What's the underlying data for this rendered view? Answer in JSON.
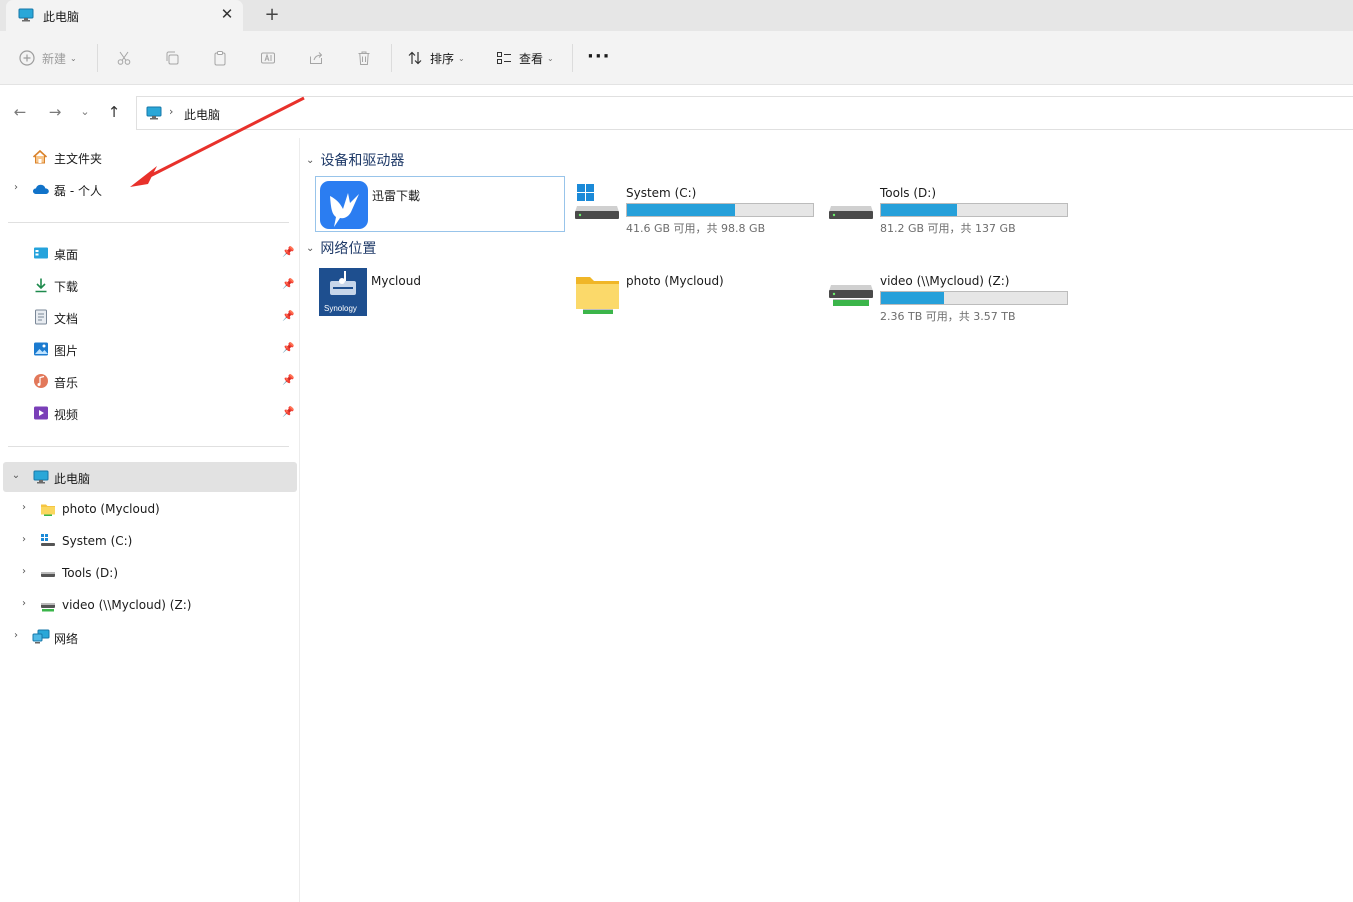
{
  "tab": {
    "title": "此电脑",
    "close": "✕",
    "new_tab": "+"
  },
  "toolbar": {
    "new_label": "新建",
    "sort_label": "排序",
    "view_label": "查看",
    "more": "···"
  },
  "address": {
    "crumb": "此电脑"
  },
  "sidebar": {
    "home": "主文件夹",
    "onedrive": "磊 - 个人",
    "quick": [
      {
        "label": "桌面"
      },
      {
        "label": "下载"
      },
      {
        "label": "文档"
      },
      {
        "label": "图片"
      },
      {
        "label": "音乐"
      },
      {
        "label": "视频"
      }
    ],
    "this_pc": "此电脑",
    "pc_children": [
      {
        "label": "photo (Mycloud)"
      },
      {
        "label": "System (C:)"
      },
      {
        "label": "Tools (D:)"
      },
      {
        "label": "video (\\\\Mycloud) (Z:)"
      }
    ],
    "network": "网络"
  },
  "main": {
    "devices_header": "设备和驱动器",
    "network_header": "网络位置",
    "devices": [
      {
        "name": "迅雷下載"
      },
      {
        "name": "System (C:)",
        "size_text": "41.6 GB 可用，共 98.8 GB",
        "used_fraction": 0.58
      },
      {
        "name": "Tools (D:)",
        "size_text": "81.2 GB 可用，共 137 GB",
        "used_fraction": 0.41
      }
    ],
    "network_items": [
      {
        "name": "Mycloud",
        "logo_text": "Synology"
      },
      {
        "name": "photo (Mycloud)"
      },
      {
        "name": "video (\\\\Mycloud) (Z:)",
        "size_text": "2.36 TB 可用，共 3.57 TB",
        "used_fraction": 0.34
      }
    ]
  },
  "colors": {
    "accent": "#26a0da",
    "annotation_arrow": "#e8312b",
    "header_text": "#1f3a68"
  }
}
